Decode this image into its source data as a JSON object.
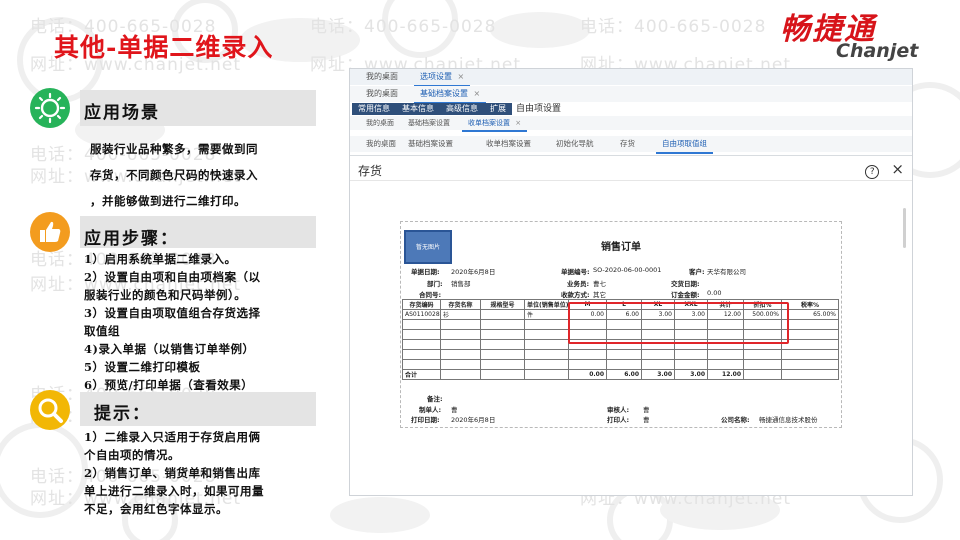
{
  "slide": {
    "title": "其他-单据二维录入",
    "brand_cn": "畅捷通",
    "brand_en": "Chanjet",
    "watermark_phone": "电话：400-665-0028",
    "watermark_url": "网址：www.chanjet.net"
  },
  "sections": {
    "scenario": {
      "title": "应用场景",
      "lines": [
        "服装行业品种繁多，需要做到同",
        "存货，不同颜色尺码的快速录入",
        "，并能够做到进行二维打印。"
      ]
    },
    "steps": {
      "title": "应用步骤：",
      "lines": [
        "1）启用系统单据二维录入。",
        "2）设置自由项和自由项档案（以",
        "服装行业的颜色和尺码举例）。",
        "3）设置自由项取值组合存货选择",
        "取值组",
        "4)录入单据（以销售订单举例）",
        "5）设置二维打印模板",
        "6）预览/打印单据（查看效果）"
      ]
    },
    "tips": {
      "title": "提示：",
      "lines": [
        "1）二维录入只适用于存货启用俩",
        "个自由项的情况。",
        "2）销售订单、销货单和销售出库",
        "单上进行二维录入时，如果可用量",
        "不足，会用红色字体显示。"
      ]
    }
  },
  "screenshot": {
    "row1_tabs": [
      "我的桌面",
      "选项设置"
    ],
    "row2_tabs": [
      "我的桌面",
      "基础档案设置"
    ],
    "row3_tabs": [
      "常用信息",
      "基本信息",
      "高级信息",
      "扩展",
      "自由项设置"
    ],
    "row4_tabs": [
      "我的桌面",
      "基础档案设置",
      "收单档案设置"
    ],
    "row5_tabs": [
      "我的桌面",
      "基础档案设置",
      "收单档案设置",
      "初始化导航",
      "存货",
      "自由项取值组"
    ],
    "close_symbol": "×",
    "dialog": {
      "title": "存货",
      "help_icon": "?",
      "close_icon": "×"
    },
    "order": {
      "image_label": "暂无图片",
      "title": "销售订单",
      "date_label": "单据日期:",
      "date": "2020年6月8日",
      "no_label": "单据编号:",
      "no": "SO-2020-06-00-0001",
      "customer_label": "客户:",
      "customer": "天华有限公司",
      "dept_label": "部门:",
      "dept": "销售部",
      "salesman_label": "业务员:",
      "salesman": "曹七",
      "delivery_label": "交货日期:",
      "delivery": "",
      "contract_label": "合同号:",
      "contract": "",
      "collect_label": "收款方式:",
      "collect": "其它",
      "deposit_label": "订金金额:",
      "deposit": "0.00",
      "headers": [
        "存货编码",
        "存货名称",
        "规格型号",
        "单位(销售单位)",
        "M",
        "L",
        "XL",
        "XXL",
        "共计",
        "折扣%",
        "税率%"
      ],
      "rows": [
        [
          "AS0110028",
          "衫",
          "",
          "件",
          "0.00",
          "6.00",
          "3.00",
          "3.00",
          "12.00",
          "500.00%",
          "65.00%"
        ]
      ],
      "empty_rows": 5,
      "total_label": "合计",
      "totals": [
        "0.00",
        "6.00",
        "3.00",
        "3.00",
        "12.00"
      ],
      "remark_label": "备注:",
      "maker_label": "制单人:",
      "maker": "曹",
      "auditor_label": "审核人:",
      "auditor": "曹",
      "print_date_label": "打印日期:",
      "print_date": "2020年6月8日",
      "printer_label": "打印人:",
      "printer": "曹",
      "company_label": "公司名称:",
      "company": "畅捷通信息技术股份"
    }
  },
  "colors": {
    "title_red": "#e0151b",
    "section_bar": "#e4e4e4",
    "icon_green": "#27b35a",
    "icon_orange": "#f39c1f",
    "icon_yellow": "#f2b705",
    "highlight_red": "#e0262a",
    "active_tab": "#1e5fb3"
  }
}
